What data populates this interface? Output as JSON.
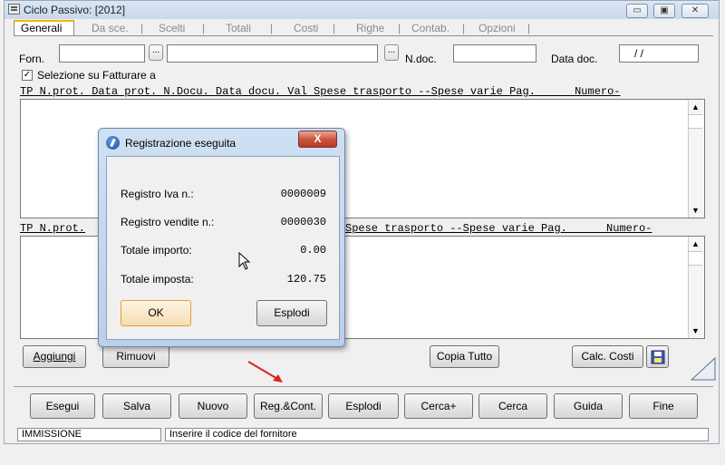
{
  "window": {
    "title": "Ciclo Passivo: [2012]",
    "controls": {
      "minimize": "▭",
      "maximize": "▣",
      "close": "✕"
    }
  },
  "tabs": [
    "Generali",
    "Da sce.",
    "Scelti",
    "Totali",
    "Costi",
    "Righe",
    "Contab.",
    "Opzioni"
  ],
  "form": {
    "forn_label": "Forn.",
    "forn_value": "",
    "forn_name_value": "",
    "dots": "...",
    "ndoc_label": "N.doc.",
    "ndoc_value": "",
    "data_doc_label": "Data doc.",
    "data_doc_value": "/ /",
    "checkbox_label": "Selezione su Fatturare a",
    "checkbox_mark": "✓"
  },
  "grid1_header": "TP N.prot. Data prot. N.Docu. Data docu. Val Spese trasporto --Spese varie Pag.      Numero-",
  "grid2_header_left": "TP N.prot.",
  "grid2_header_right": "Spese trasporto --Spese varie Pag.      Numero-",
  "scroll": {
    "up": "▲",
    "down": "▼"
  },
  "mid_buttons": {
    "aggiungi": "Aggiungi",
    "rimuovi": "Rimuovi",
    "copia_tutto": "Copia Tutto",
    "calc_costi": "Calc. Costi"
  },
  "bottom_buttons": [
    "Esegui",
    "Salva",
    "Nuovo",
    "Reg.&Cont.",
    "Esplodi",
    "Cerca+",
    "Cerca",
    "Guida",
    "Fine"
  ],
  "status": {
    "mode": "IMMISSIONE",
    "message": "Inserire il codice del fornitore"
  },
  "dialog": {
    "title": "Registrazione eseguita",
    "close": "X",
    "rows": [
      {
        "label": "Registro Iva n.:",
        "value": "0000009"
      },
      {
        "label": "Registro vendite n.:",
        "value": "0000030"
      },
      {
        "label": "Totale importo:",
        "value": "0.00"
      },
      {
        "label": "Totale imposta:",
        "value": "120.75"
      }
    ],
    "ok": "OK",
    "esplodi": "Esplodi"
  },
  "colors": {
    "accent_tab": "#f0b400",
    "dialog_close": "#c9503a",
    "arrow": "#e02020"
  }
}
